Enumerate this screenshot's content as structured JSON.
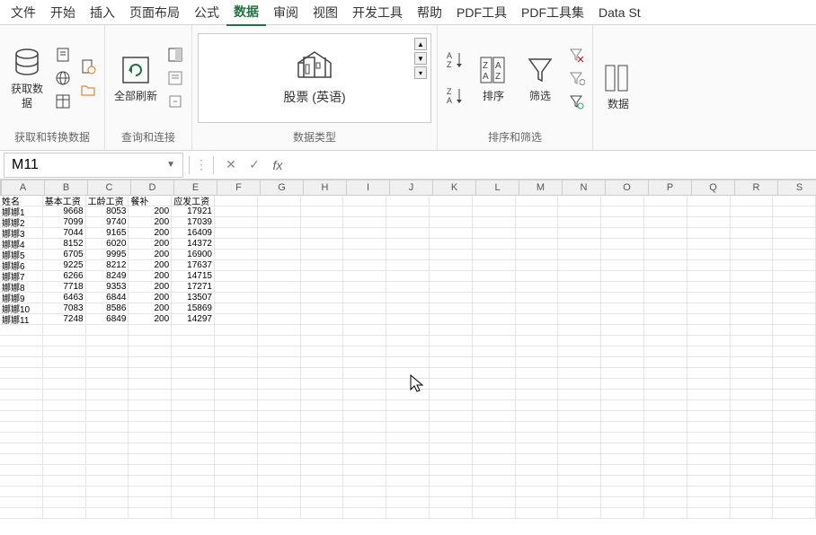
{
  "tabs": {
    "items": [
      "文件",
      "开始",
      "插入",
      "页面布局",
      "公式",
      "数据",
      "审阅",
      "视图",
      "开发工具",
      "帮助",
      "PDF工具",
      "PDF工具集",
      "Data St"
    ],
    "active_index": 5
  },
  "ribbon": {
    "group1": {
      "label": "获取和转换数据",
      "btn_label": "获取数\n据"
    },
    "group2": {
      "label": "查询和连接",
      "btn_label": "全部刷新"
    },
    "group3": {
      "label": "数据类型",
      "datatype_name": "股票 (英语)"
    },
    "group4": {
      "label": "排序和筛选",
      "sort_label": "排序",
      "filter_label": "筛选"
    },
    "group5": {
      "label": "数据"
    }
  },
  "namebox": {
    "value": "M11"
  },
  "formula_bar": {
    "value": ""
  },
  "columns": [
    "A",
    "B",
    "C",
    "D",
    "E",
    "F",
    "G",
    "H",
    "I",
    "J",
    "K",
    "L",
    "M",
    "N",
    "O",
    "P",
    "Q",
    "R",
    "S"
  ],
  "headers": [
    "姓名",
    "基本工资",
    "工龄工资",
    "餐补",
    "应发工资"
  ],
  "rows": [
    {
      "name": "娜娜1",
      "base": 9668,
      "sen": 8053,
      "meal": 200,
      "total": 17921
    },
    {
      "name": "娜娜2",
      "base": 7099,
      "sen": 9740,
      "meal": 200,
      "total": 17039
    },
    {
      "name": "娜娜3",
      "base": 7044,
      "sen": 9165,
      "meal": 200,
      "total": 16409
    },
    {
      "name": "娜娜4",
      "base": 8152,
      "sen": 6020,
      "meal": 200,
      "total": 14372
    },
    {
      "name": "娜娜5",
      "base": 6705,
      "sen": 9995,
      "meal": 200,
      "total": 16900
    },
    {
      "name": "娜娜6",
      "base": 9225,
      "sen": 8212,
      "meal": 200,
      "total": 17637
    },
    {
      "name": "娜娜7",
      "base": 6266,
      "sen": 8249,
      "meal": 200,
      "total": 14715
    },
    {
      "name": "娜娜8",
      "base": 7718,
      "sen": 9353,
      "meal": 200,
      "total": 17271
    },
    {
      "name": "娜娜9",
      "base": 6463,
      "sen": 6844,
      "meal": 200,
      "total": 13507
    },
    {
      "name": "娜娜10",
      "base": 7083,
      "sen": 8586,
      "meal": 200,
      "total": 15869
    },
    {
      "name": "娜娜11",
      "base": 7248,
      "sen": 6849,
      "meal": 200,
      "total": 14297
    }
  ]
}
